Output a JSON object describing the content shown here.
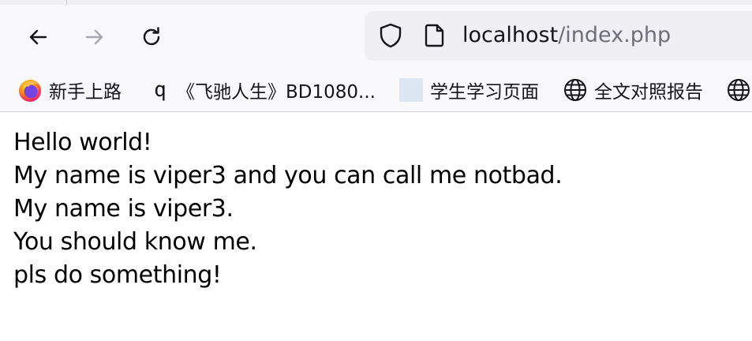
{
  "browser": {
    "nav": {
      "back_icon": "arrow-left-icon",
      "forward_icon": "arrow-right-icon",
      "reload_icon": "reload-icon"
    },
    "address_bar": {
      "host": "localhost",
      "path": "/index.php",
      "security_icon": "shield-icon",
      "page_icon": "page-icon"
    },
    "bookmarks": [
      {
        "label": "新手上路",
        "icon": "firefox-icon"
      },
      {
        "label": "《飞驰人生》BD1080...",
        "icon": "q-icon",
        "icon_text": "q"
      },
      {
        "label": "学生学习页面",
        "icon": "blank-favicon"
      },
      {
        "label": "全文对照报告",
        "icon": "globe-icon"
      },
      {
        "label": "",
        "icon": "globe-icon"
      }
    ],
    "colors": {
      "toolbar_bg": "#f9f9fb",
      "urlbar_bg": "#f0f0f4",
      "text": "#15141a",
      "muted": "#6e6e78"
    }
  },
  "page": {
    "lines": [
      "Hello world!",
      "My name is viper3 and you can call me notbad.",
      "My name is viper3.",
      "You should know me.",
      "pls do something!"
    ]
  }
}
